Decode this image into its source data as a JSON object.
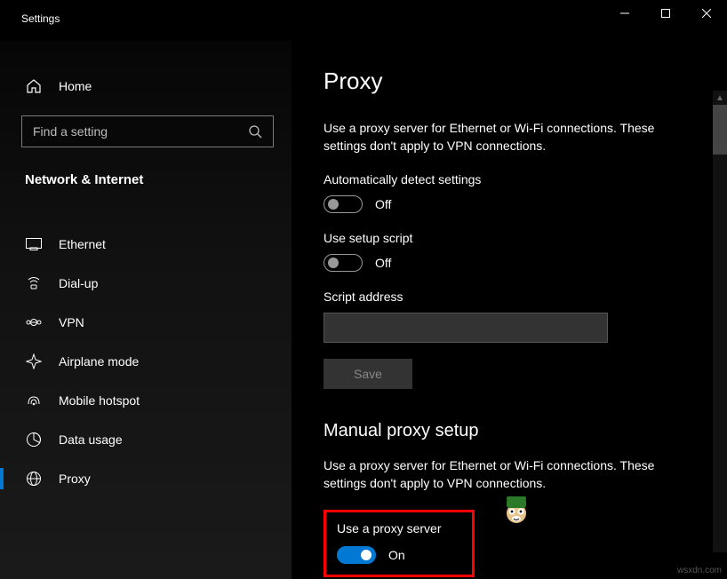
{
  "app": {
    "title": "Settings"
  },
  "sidebar": {
    "home_label": "Home",
    "search_placeholder": "Find a setting",
    "section_title": "Network & Internet",
    "items": [
      {
        "label": "Ethernet"
      },
      {
        "label": "Dial-up"
      },
      {
        "label": "VPN"
      },
      {
        "label": "Airplane mode"
      },
      {
        "label": "Mobile hotspot"
      },
      {
        "label": "Data usage"
      },
      {
        "label": "Proxy",
        "selected": true
      }
    ]
  },
  "main": {
    "page_title": "Proxy",
    "intro": "Use a proxy server for Ethernet or Wi-Fi connections. These settings don't apply to VPN connections.",
    "auto_detect_label": "Automatically detect settings",
    "auto_detect_value": "Off",
    "use_script_label": "Use setup script",
    "use_script_value": "Off",
    "script_address_label": "Script address",
    "script_address_value": "",
    "save_label": "Save",
    "manual_heading": "Manual proxy setup",
    "manual_intro": "Use a proxy server for Ethernet or Wi-Fi connections. These settings don't apply to VPN connections.",
    "use_proxy_label": "Use a proxy server",
    "use_proxy_value": "On"
  },
  "watermark": "wsxdn.com"
}
